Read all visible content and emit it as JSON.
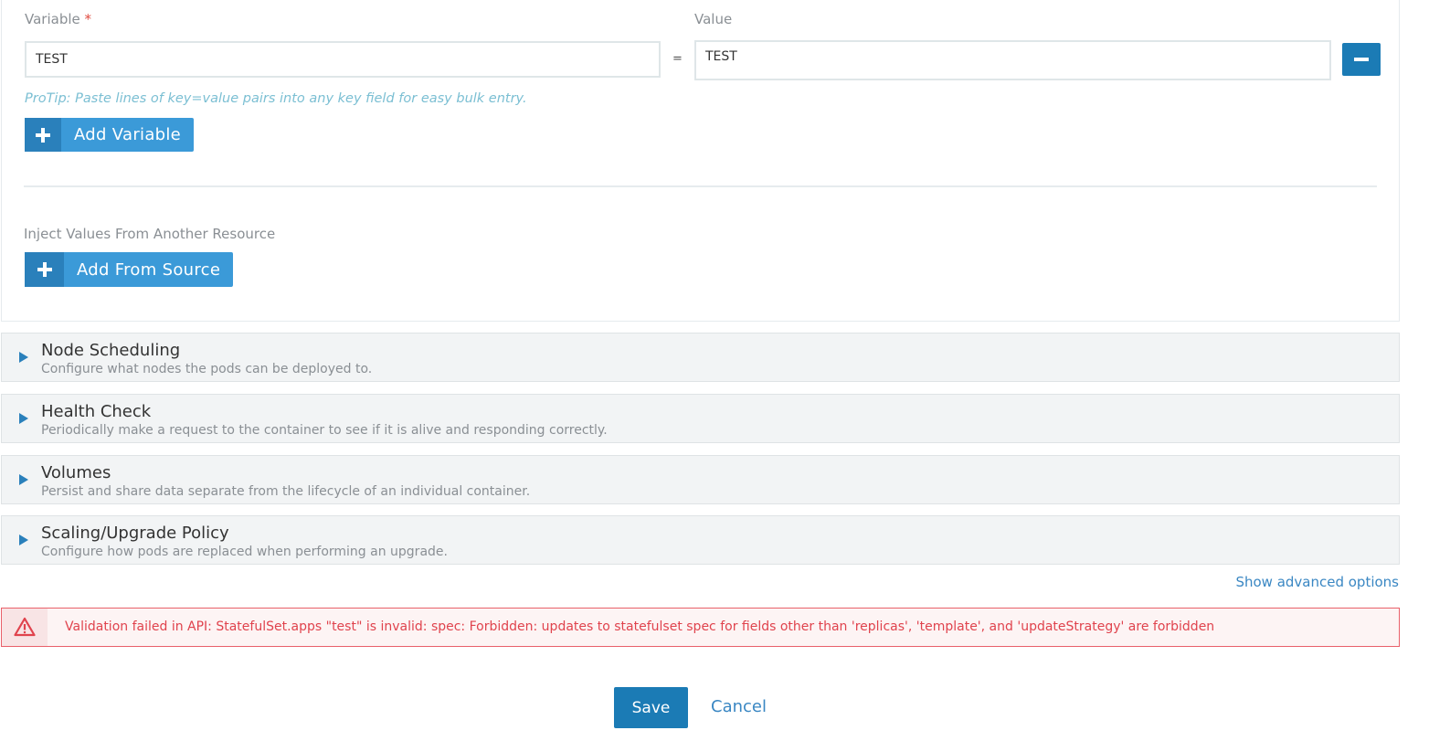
{
  "env": {
    "variable_label": "Variable",
    "required_mark": "*",
    "value_label": "Value",
    "equals": "=",
    "rows": [
      {
        "key": "TEST",
        "value": "TEST"
      }
    ],
    "protip": "ProTip: Paste lines of key=value pairs into any key field for easy bulk entry.",
    "add_variable_label": "Add Variable",
    "inject_label": "Inject Values From Another Resource",
    "add_from_source_label": "Add From Source"
  },
  "sections": [
    {
      "title": "Node Scheduling",
      "description": "Configure what nodes the pods can be deployed to."
    },
    {
      "title": "Health Check",
      "description": "Periodically make a request to the container to see if it is alive and responding correctly."
    },
    {
      "title": "Volumes",
      "description": "Persist and share data separate from the lifecycle of an individual container."
    },
    {
      "title": "Scaling/Upgrade Policy",
      "description": "Configure how pods are replaced when performing an upgrade."
    }
  ],
  "advanced_link": "Show advanced options",
  "error": {
    "message": "Validation failed in API: StatefulSet.apps \"test\" is invalid: spec: Forbidden: updates to statefulset spec for fields other than 'replicas', 'template', and 'updateStrategy' are forbidden",
    "icon": "warning-triangle-icon"
  },
  "footer": {
    "save_label": "Save",
    "cancel_label": "Cancel"
  },
  "colors": {
    "primary": "#1b7bb5",
    "accent": "#3b9ad8",
    "error": "#e0434d",
    "link": "#3a87c3"
  }
}
